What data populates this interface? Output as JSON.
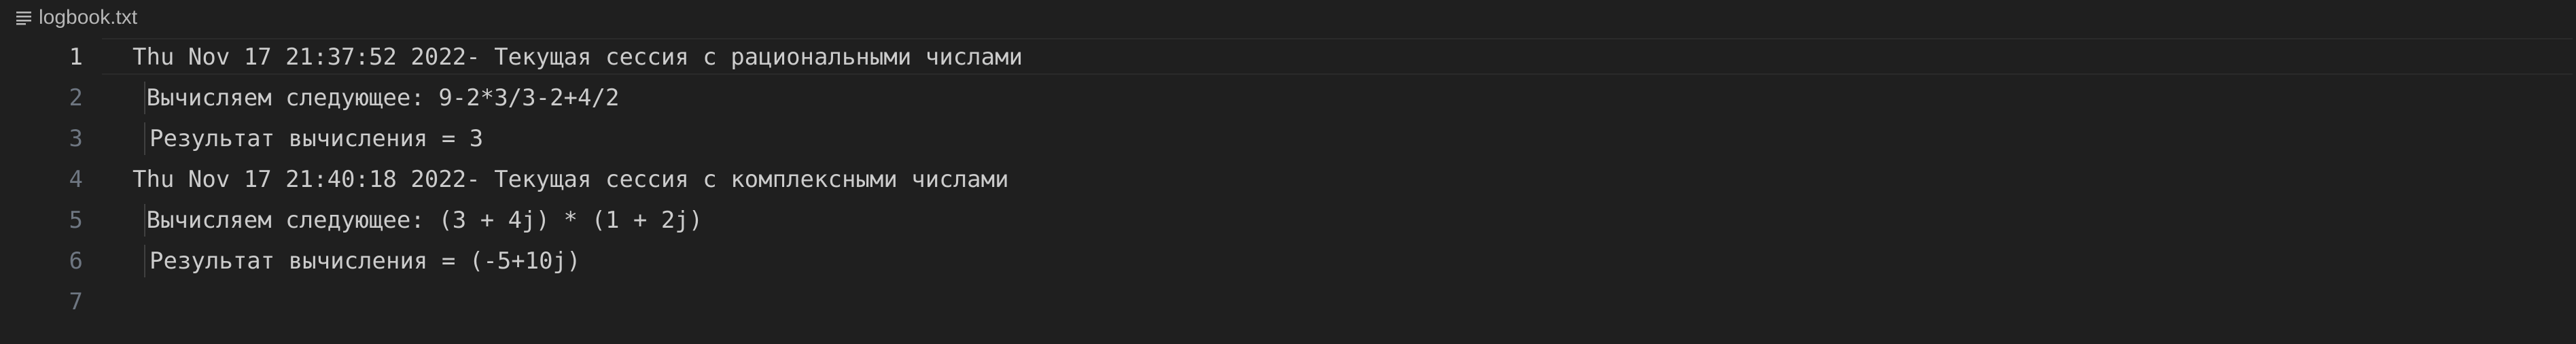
{
  "breadcrumb": {
    "icon": "text-lines-icon",
    "file_name": "logbook.txt"
  },
  "editor": {
    "active_line": 1,
    "lines": [
      {
        "number": "1",
        "text": "Thu Nov 17 21:37:52 2022- Текущая сессия с рациональными числами"
      },
      {
        "number": "2",
        "text": " Вычисляем следующее: 9-2*3/3-2+4/2"
      },
      {
        "number": "3",
        "text": "Результат вычисления = 3"
      },
      {
        "number": "4",
        "text": "Thu Nov 17 21:40:18 2022- Текущая сессия с комплексными числами"
      },
      {
        "number": "5",
        "text": " Вычисляем следующее: (3 + 4j) * (1 + 2j)"
      },
      {
        "number": "6",
        "text": "Результат вычисления = (-5+10j)"
      },
      {
        "number": "7",
        "text": ""
      }
    ]
  },
  "colors": {
    "background": "#1f1f1f",
    "text": "#cccccc",
    "line_number": "#6e7681",
    "active_line_number": "#cccccc",
    "current_line_border": "#2a2a2a",
    "indent_guide": "#404040"
  }
}
